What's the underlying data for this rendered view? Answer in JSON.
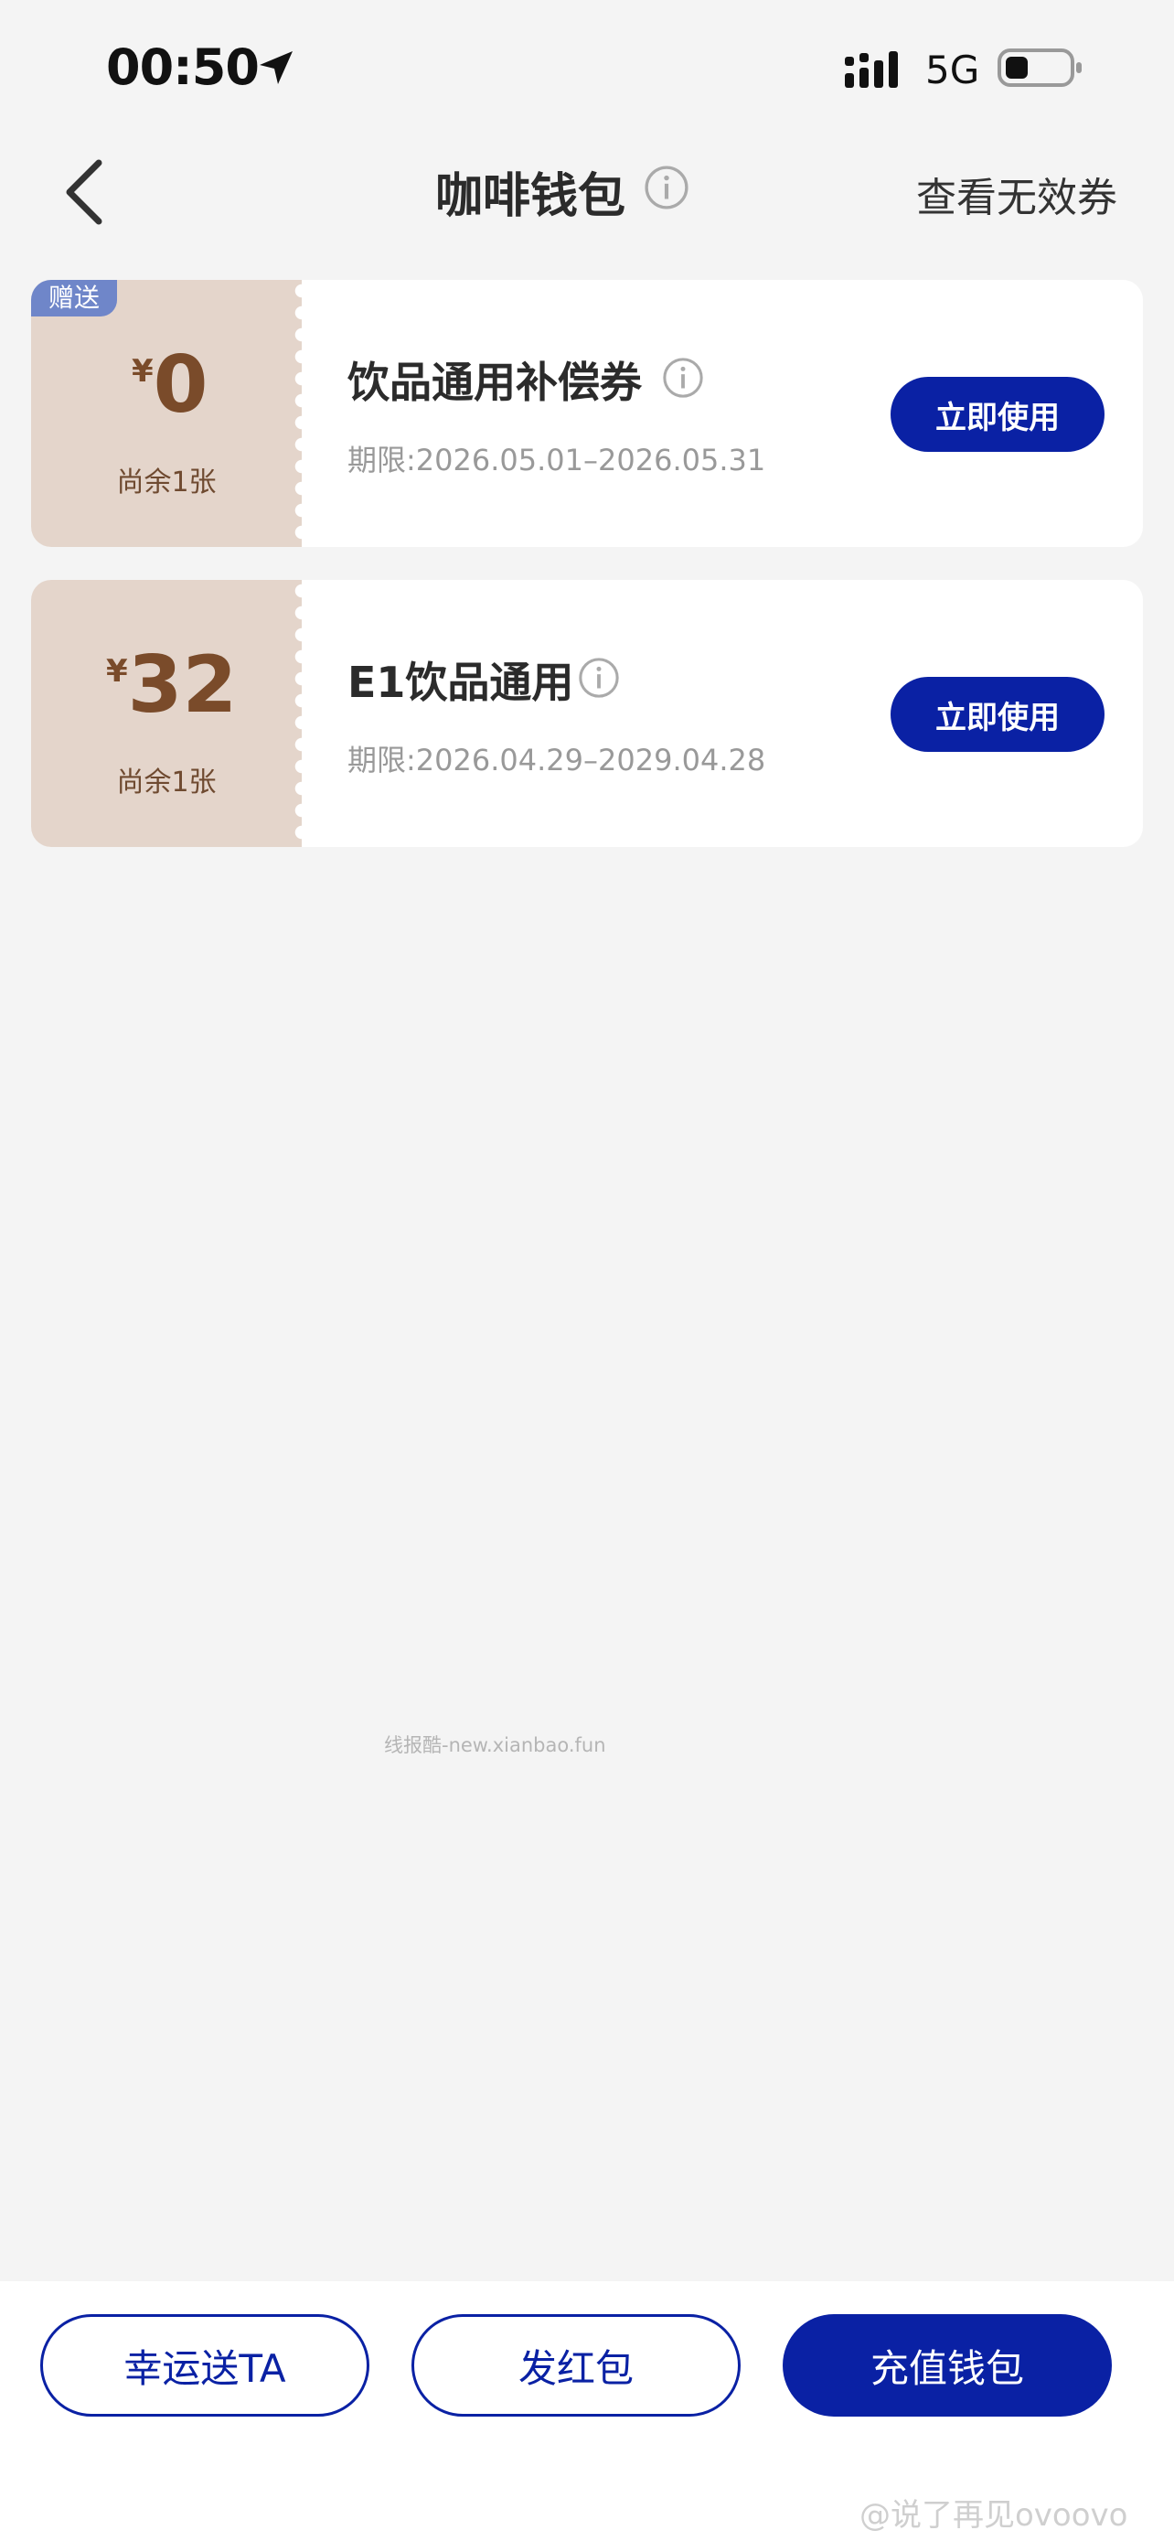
{
  "status_bar": {
    "time": "00:50",
    "network": "5G",
    "icons": [
      "location-arrow-icon",
      "signal-icon",
      "battery-icon"
    ]
  },
  "nav": {
    "title": "咖啡钱包",
    "right_link": "查看无效券",
    "icons": [
      "back-chevron-icon",
      "info-icon"
    ]
  },
  "coupons": [
    {
      "tag": "赠送",
      "currency": "¥",
      "amount": "0",
      "remaining": "尚余1张",
      "name": "饮品通用补偿券",
      "validity": "期限:2026.05.01–2026.05.31",
      "button": "立即使用"
    },
    {
      "tag": "",
      "currency": "¥",
      "amount": "32",
      "remaining": "尚余1张",
      "name": "E1饮品通用",
      "validity": "期限:2026.04.29–2029.04.28",
      "button": "立即使用"
    }
  ],
  "watermark": "线报酷-new.xianbao.fun",
  "bottom_bar": {
    "gift_label": "幸运送TA",
    "red_packet_label": "发红包",
    "recharge_label": "充值钱包"
  },
  "weibo_watermark": "@说了再见ovoovo",
  "colors": {
    "brand_blue": "#0a21a4",
    "coupon_left_bg": "#e4d5cb",
    "amount_brown": "#7a4b2a",
    "gift_tag_bg": "#6f86c9",
    "page_bg": "#f4f4f4"
  }
}
